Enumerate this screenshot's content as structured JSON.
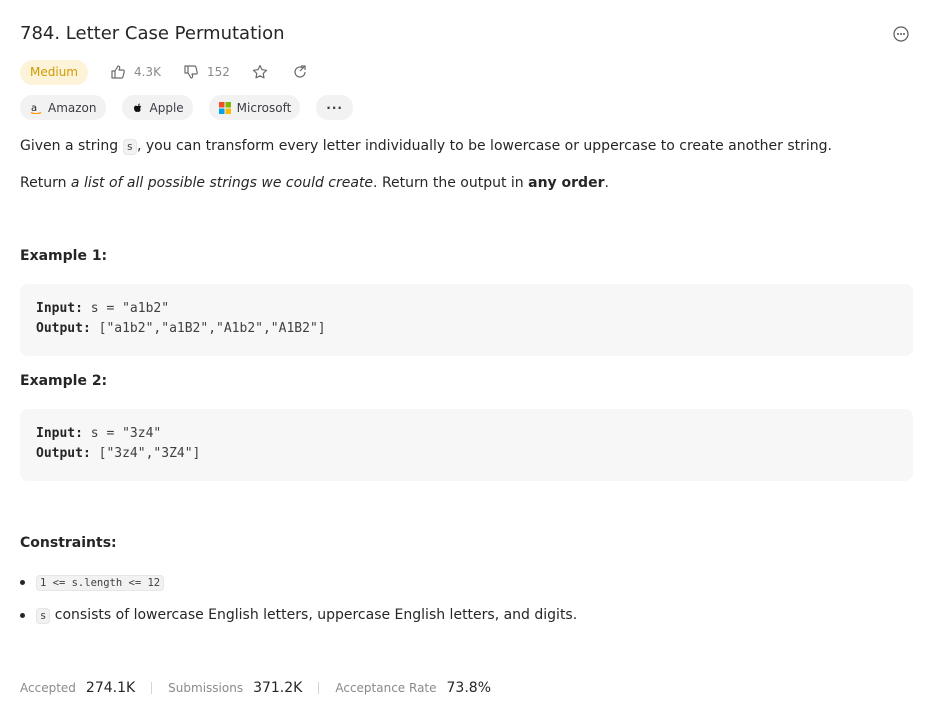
{
  "problem": {
    "title": "784. Letter Case Permutation",
    "difficulty": "Medium",
    "likes": "4.3K",
    "dislikes": "152",
    "companies": [
      "Amazon",
      "Apple",
      "Microsoft"
    ],
    "more_companies_label": "···"
  },
  "description": {
    "p1_before": "Given a string ",
    "p1_code": "s",
    "p1_after": ", you can transform every letter individually to be lowercase or uppercase to create another string.",
    "p2_before": "Return ",
    "p2_italic": "a list of all possible strings we could create",
    "p2_middle": ". Return the output in ",
    "p2_bold": "any order",
    "p2_end": "."
  },
  "examples": [
    {
      "title": "Example 1:",
      "input_label": "Input:",
      "input_value": "s = \"a1b2\"",
      "output_label": "Output:",
      "output_value": "[\"a1b2\",\"a1B2\",\"A1b2\",\"A1B2\"]"
    },
    {
      "title": "Example 2:",
      "input_label": "Input:",
      "input_value": "s = \"3z4\"",
      "output_label": "Output:",
      "output_value": "[\"3z4\",\"3Z4\"]"
    }
  ],
  "constraints": {
    "title": "Constraints:",
    "c1_code": "1 <= s.length <= 12",
    "c2_code": "s",
    "c2_text": " consists of lowercase English letters, uppercase English letters, and digits."
  },
  "stats": {
    "accepted_label": "Accepted",
    "accepted_value": "274.1K",
    "submissions_label": "Submissions",
    "submissions_value": "371.2K",
    "rate_label": "Acceptance Rate",
    "rate_value": "73.8%"
  },
  "colors": {
    "medium_text": "#d19900",
    "medium_bg": "#fcf3d9"
  },
  "icons": [
    "more-icon",
    "thumbs-up-icon",
    "thumbs-down-icon",
    "star-icon",
    "share-icon",
    "amazon-logo",
    "apple-logo",
    "microsoft-logo"
  ]
}
